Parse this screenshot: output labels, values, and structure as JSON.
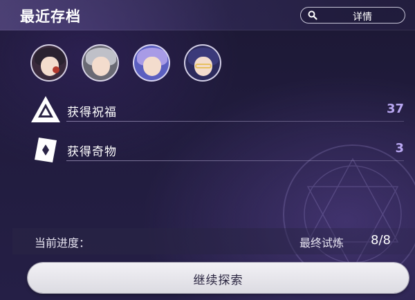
{
  "header": {
    "title": "最近存档",
    "details_button_label": "详情"
  },
  "team": {
    "avatars": [
      {
        "name": "avatar-1",
        "hair_color": "#2a2230",
        "accent": "#b23a2e"
      },
      {
        "name": "avatar-2",
        "hair_color": "#bfc0c8",
        "accent": "#5a5a66"
      },
      {
        "name": "avatar-3",
        "hair_color": "#a89be6",
        "accent": "#4a5cd0"
      },
      {
        "name": "avatar-4",
        "hair_color": "#3b3a7a",
        "accent": "#e8c060"
      }
    ]
  },
  "stats": [
    {
      "label": "获得祝福",
      "value": "37",
      "icon": "blessing-icon"
    },
    {
      "label": "获得奇物",
      "value": "3",
      "icon": "curio-icon"
    }
  ],
  "progress": {
    "label": "当前进度：",
    "stage_name": "最终试炼",
    "stage_count": "8/8"
  },
  "continue_button_label": "继续探索",
  "colors": {
    "value_accent": "#b9a7f2",
    "button_bg": "#eceaf0"
  }
}
